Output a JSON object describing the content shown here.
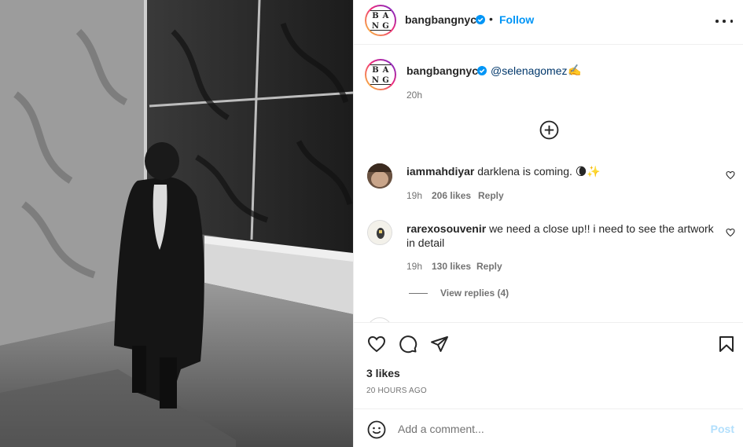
{
  "header": {
    "username": "bangbangnyc",
    "separator": "•",
    "follow_label": "Follow",
    "more_icon": "more-horizontal-icon"
  },
  "logo": {
    "letters": [
      "B",
      "A",
      "N",
      "G"
    ]
  },
  "caption": {
    "username": "bangbangnyc",
    "mention": "@selenagomez",
    "emoji": "✍️",
    "time": "20h"
  },
  "comments": [
    {
      "username": "iammahdiyar",
      "text": "darklena is coming. 🌘✨",
      "time": "19h",
      "likes": "206 likes",
      "reply_label": "Reply"
    },
    {
      "username": "rarexosouvenir",
      "text_line1": "we need a close up!! i need to see the artwork",
      "text_line2": "in detail",
      "time": "19h",
      "likes": "130 likes",
      "reply_label": "Reply"
    }
  ],
  "view_replies": "View replies (4)",
  "stats": {
    "likes": "3 likes",
    "timestamp": "20 HOURS AGO"
  },
  "add_comment": {
    "placeholder": "Add a comment...",
    "post_label": "Post"
  },
  "colors": {
    "link_blue": "#0095f6",
    "mention_blue": "#00376b",
    "verified_blue": "#0095f6",
    "muted": "#737373",
    "post_disabled": "#b2dffc"
  }
}
